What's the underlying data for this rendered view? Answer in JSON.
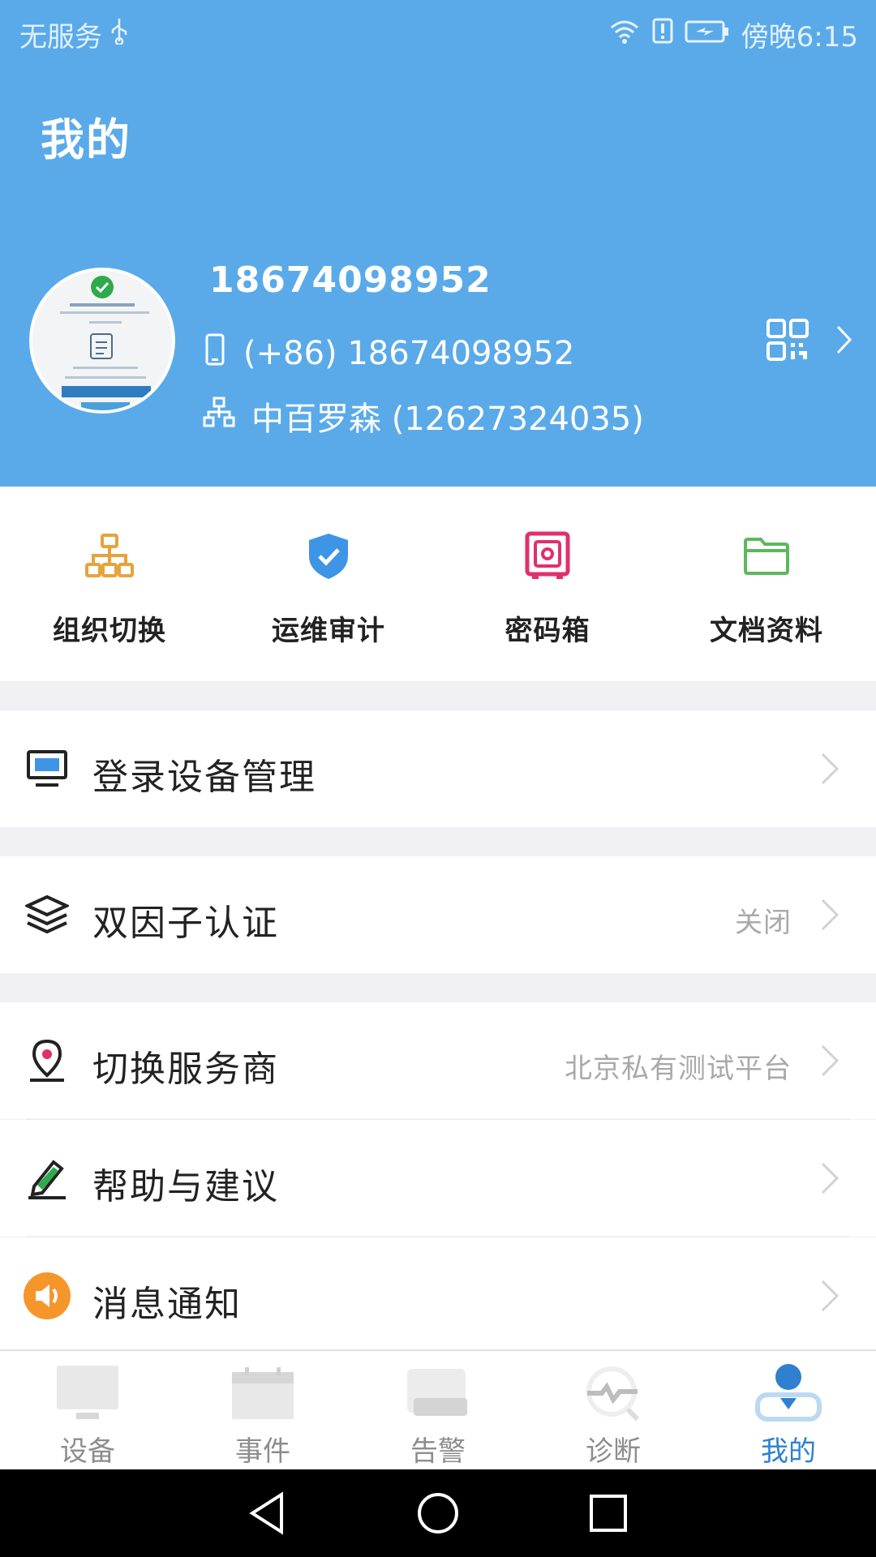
{
  "status_bar": {
    "carrier": "无服务",
    "time": "傍晚6:15"
  },
  "header": {
    "title": "我的",
    "username": "18674098952",
    "phone": "(+86) 18674098952",
    "organization": "中百罗森 (12627324035)"
  },
  "quick_actions": [
    {
      "label": "组织切换",
      "icon": "org-switch-icon",
      "color": "#e8a23c"
    },
    {
      "label": "运维审计",
      "icon": "shield-check-icon",
      "color": "#3e95e6"
    },
    {
      "label": "密码箱",
      "icon": "safe-icon",
      "color": "#e0306b"
    },
    {
      "label": "文档资料",
      "icon": "folder-icon",
      "color": "#5cb85c"
    }
  ],
  "menu": {
    "login_devices": {
      "label": "登录设备管理"
    },
    "two_factor": {
      "label": "双因子认证",
      "value": "关闭"
    },
    "switch_provider": {
      "label": "切换服务商",
      "value": "北京私有测试平台"
    },
    "help": {
      "label": "帮助与建议"
    },
    "notifications": {
      "label": "消息通知"
    }
  },
  "tabs": [
    {
      "label": "设备",
      "icon": "monitor-icon"
    },
    {
      "label": "事件",
      "icon": "calendar-icon"
    },
    {
      "label": "告警",
      "icon": "alarm-icon"
    },
    {
      "label": "诊断",
      "icon": "diagnose-icon"
    },
    {
      "label": "我的",
      "icon": "user-icon",
      "active": true
    }
  ],
  "colors": {
    "header_bg": "#5aaae9",
    "active_tab": "#2f80cf",
    "page_bg": "#f1f1f4"
  }
}
